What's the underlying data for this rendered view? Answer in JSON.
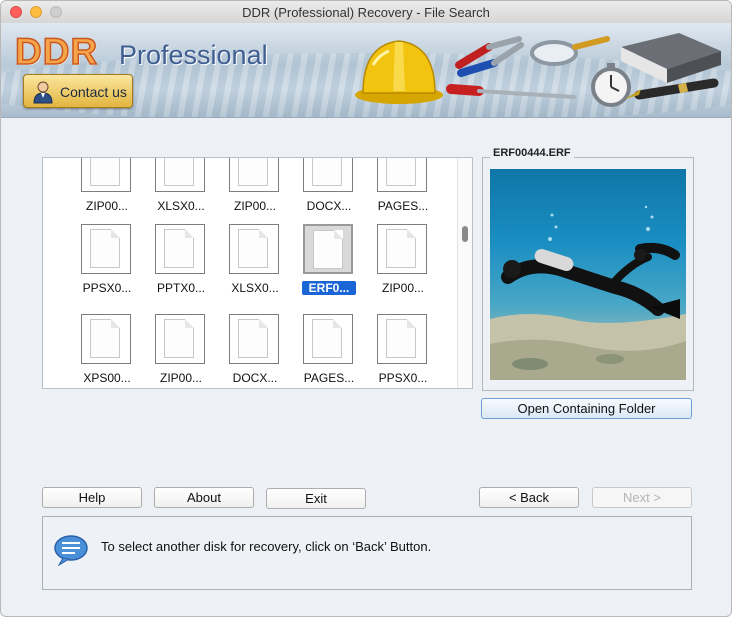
{
  "window": {
    "title": "DDR (Professional) Recovery - File Search"
  },
  "banner": {
    "brand": "DDR",
    "brand_sub": "Professional",
    "contact_label": "Contact us"
  },
  "files": [
    {
      "name": "ZIP00...",
      "selected": false
    },
    {
      "name": "XLSX0...",
      "selected": false
    },
    {
      "name": "ZIP00...",
      "selected": false
    },
    {
      "name": "DOCX...",
      "selected": false
    },
    {
      "name": "PAGES...",
      "selected": false
    },
    {
      "name": "PPSX0...",
      "selected": false
    },
    {
      "name": "PPTX0...",
      "selected": false
    },
    {
      "name": "XLSX0...",
      "selected": false
    },
    {
      "name": "ERF0...",
      "selected": true
    },
    {
      "name": "ZIP00...",
      "selected": false
    },
    {
      "name": "XPS00...",
      "selected": false
    },
    {
      "name": "ZIP00...",
      "selected": false
    },
    {
      "name": "DOCX...",
      "selected": false
    },
    {
      "name": "PAGES...",
      "selected": false
    },
    {
      "name": "PPSX0...",
      "selected": false
    }
  ],
  "preview": {
    "title": "ERF00444.ERF",
    "open_folder_label": "Open Containing Folder"
  },
  "buttons": {
    "help": "Help",
    "about": "About",
    "exit": "Exit",
    "back": "< Back",
    "next": "Next >"
  },
  "status": {
    "message": "To select another disk for recovery, click on ‘Back’ Button."
  },
  "colors": {
    "selection": "#1b66d6",
    "brand": "#f6a44a",
    "accent_border": "#6e9fd4"
  }
}
